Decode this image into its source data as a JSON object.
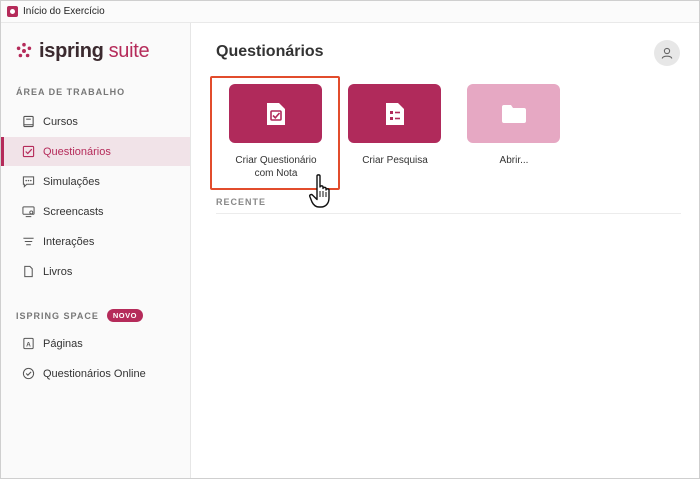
{
  "window": {
    "title": "Início do Exercício"
  },
  "sidebar": {
    "brand": {
      "name_part1": "ispring",
      "name_part2": "suite"
    },
    "workspace_label": "ÁREA DE TRABALHO",
    "workspace_items": [
      {
        "label": "Cursos",
        "icon": "book-icon",
        "active": false
      },
      {
        "label": "Questionários",
        "icon": "checkbox-icon",
        "active": true
      },
      {
        "label": "Simulações",
        "icon": "chat-bubble-icon",
        "active": false
      },
      {
        "label": "Screencasts",
        "icon": "monitor-icon",
        "active": false
      },
      {
        "label": "Interações",
        "icon": "lines-icon",
        "active": false
      },
      {
        "label": "Livros",
        "icon": "file-icon",
        "active": false
      }
    ],
    "space_label": "ISPRING SPACE",
    "space_badge": "NOVO",
    "space_items": [
      {
        "label": "Páginas",
        "icon": "page-a-icon"
      },
      {
        "label": "Questionários Online",
        "icon": "check-circle-icon"
      }
    ]
  },
  "main": {
    "title": "Questionários",
    "tiles": [
      {
        "label_line1": "Criar Questionário",
        "label_line2": "com Nota",
        "icon": "graded-quiz-icon",
        "color": "#b02a5b"
      },
      {
        "label_line1": "Criar Pesquisa",
        "label_line2": "",
        "icon": "survey-list-icon",
        "color": "#b02a5b"
      },
      {
        "label_line1": "Abrir...",
        "label_line2": "",
        "icon": "folder-icon",
        "color": "#e6a8c3"
      }
    ],
    "recent_label": "RECENTE"
  },
  "colors": {
    "accent": "#b52b5a",
    "highlight": "#e24c2c"
  }
}
